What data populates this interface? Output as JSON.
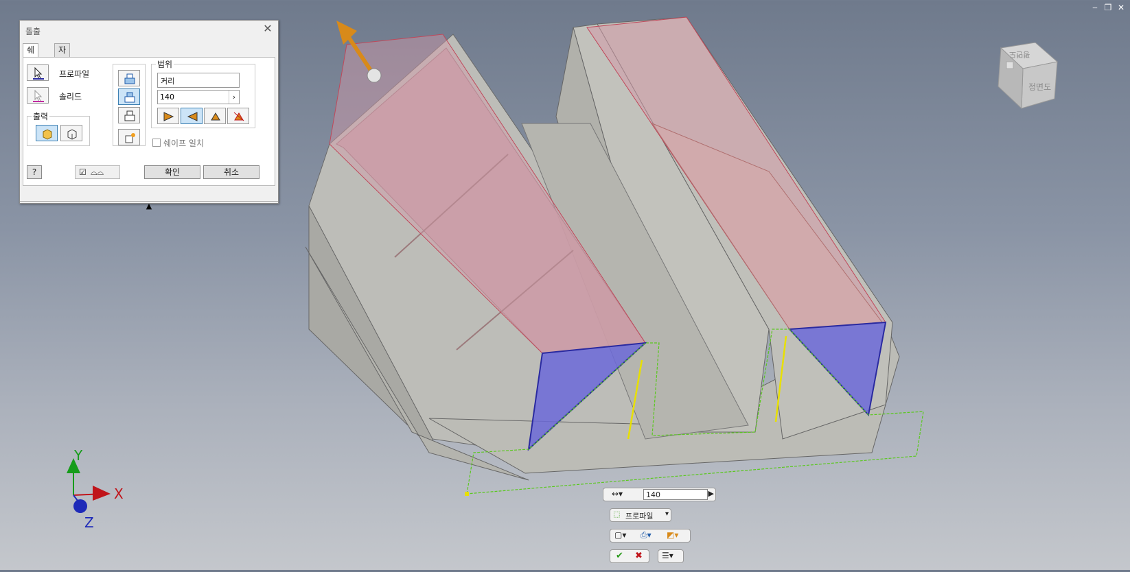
{
  "window_controls": [
    "‒",
    "❐",
    "✕"
  ],
  "dialog": {
    "title": "돌출",
    "tabs": [
      "쉐이프",
      "자세히"
    ],
    "profile_label": "프로파일",
    "solid_label": "솔리드",
    "output_label": "출력",
    "extents_label": "범위",
    "extents_value": "거리",
    "distance_value": "140",
    "match_shape_label": "쉐이프 일치",
    "ok_label": "확인",
    "cancel_label": "취소",
    "expand_glyph": "▲"
  },
  "mini_toolbar": {
    "distance_value": "140",
    "profile_label": "프로파일"
  },
  "viewcube": {
    "front_label": "정면도",
    "top_label": "평면도"
  },
  "axis": {
    "x_label": "X",
    "y_label": "Y",
    "z_label": "Z"
  },
  "colors": {
    "body": "#bdbdb8",
    "preview": "#c89aa6",
    "profile_face": "#6c6ad8",
    "x_axis": "#c0141a",
    "y_axis": "#169c1a",
    "z_axis": "#1e2ab8",
    "arrow": "#d88a1a"
  }
}
